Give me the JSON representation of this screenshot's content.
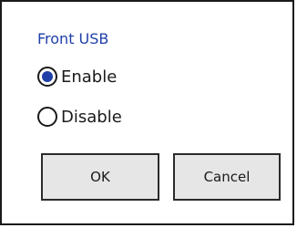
{
  "dialog": {
    "title": "Front USB",
    "options": [
      {
        "label": "Enable",
        "checked": true
      },
      {
        "label": "Disable",
        "checked": false
      }
    ],
    "buttons": {
      "ok_label": "OK",
      "cancel_label": "Cancel"
    },
    "colors": {
      "accent": "#1f3fa8",
      "button_bg": "#e6e6e6",
      "border": "#1a1a1a"
    }
  }
}
